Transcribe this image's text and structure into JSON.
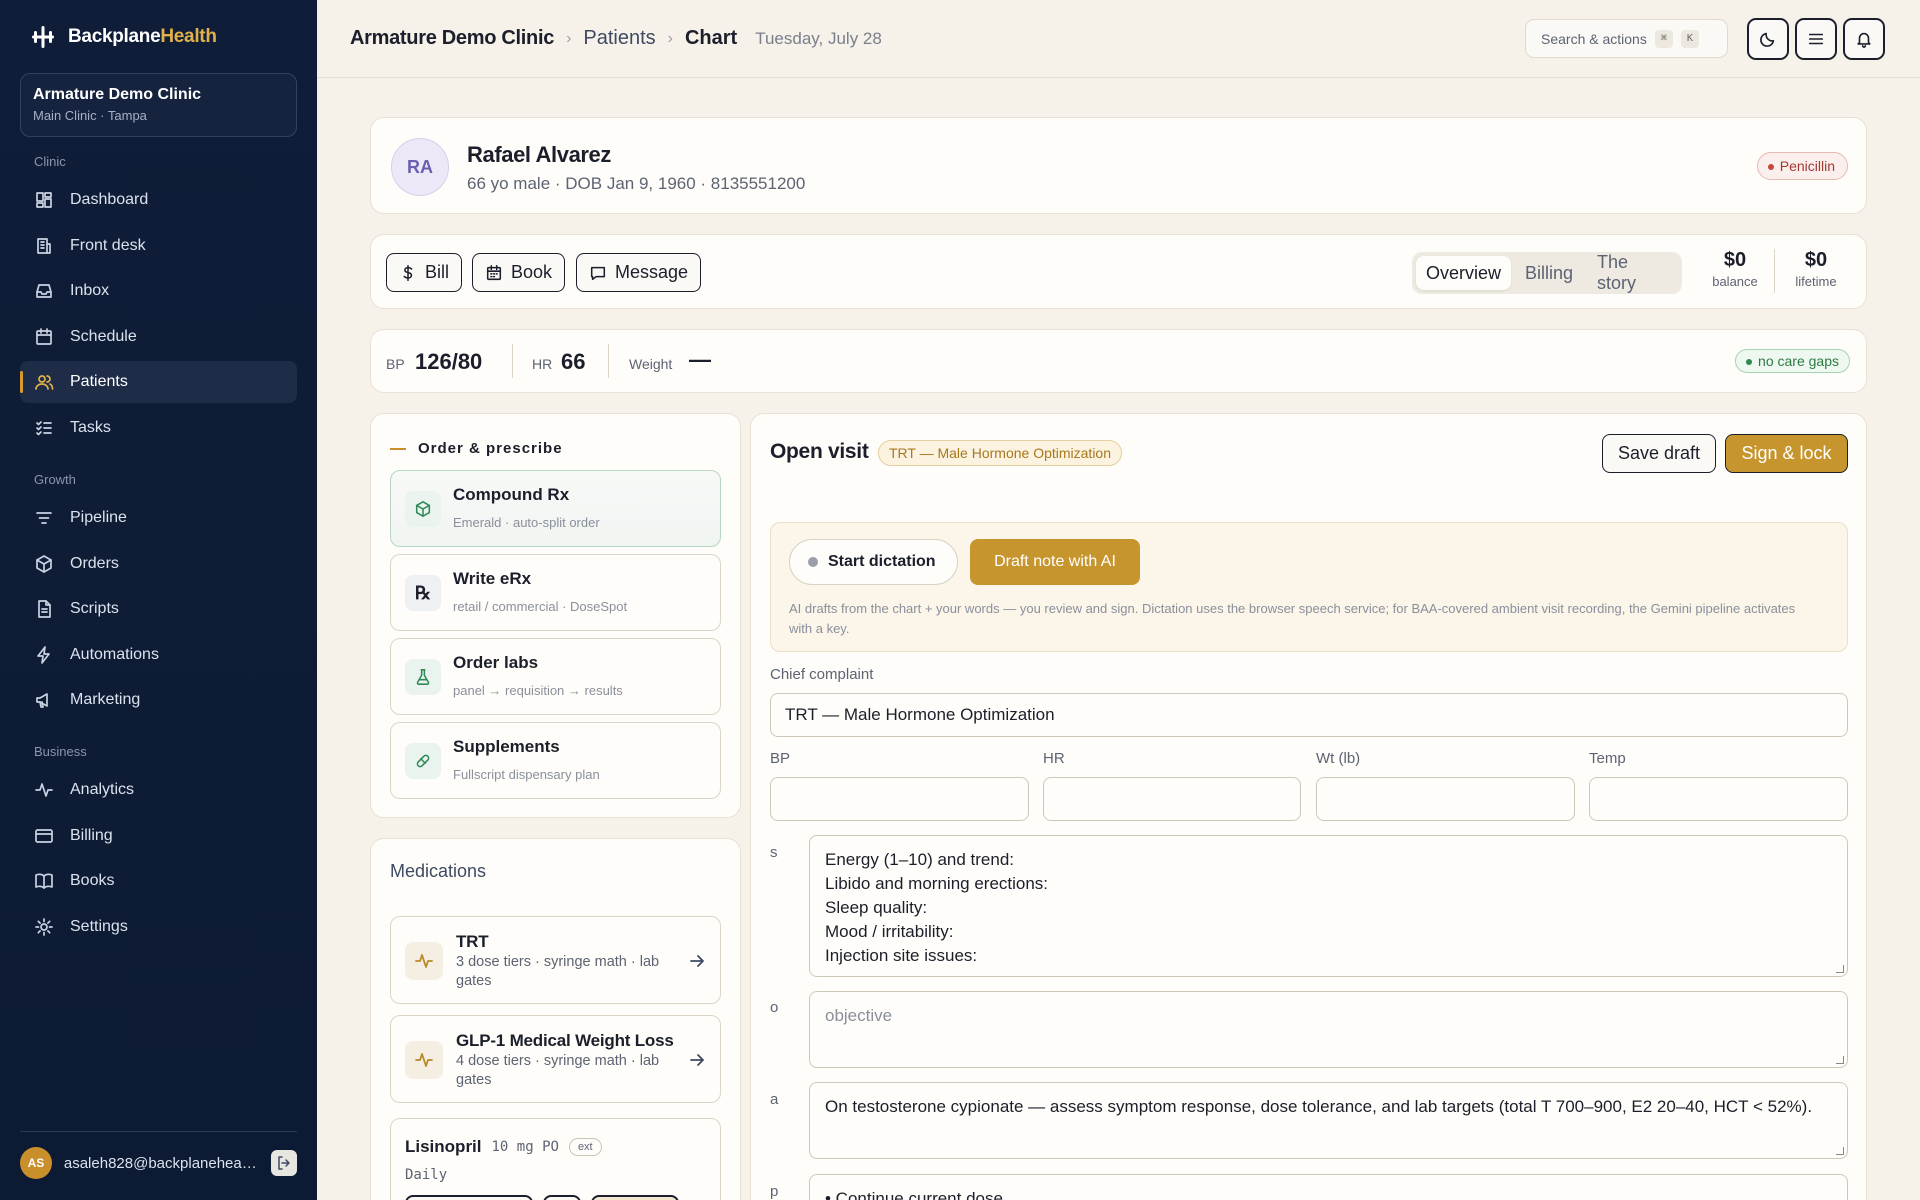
{
  "brand": {
    "name": "Backplane",
    "accent": "Health"
  },
  "clinic": {
    "name": "Armature Demo Clinic",
    "location": "Main Clinic · Tampa"
  },
  "nav": {
    "sections": [
      "Clinic",
      "Growth",
      "Business"
    ],
    "items": [
      {
        "label": "Dashboard",
        "icon": "dashboard-icon"
      },
      {
        "label": "Front desk",
        "icon": "building-icon"
      },
      {
        "label": "Inbox",
        "icon": "inbox-icon"
      },
      {
        "label": "Schedule",
        "icon": "calendar-icon"
      },
      {
        "label": "Patients",
        "icon": "users-icon",
        "active": true
      },
      {
        "label": "Tasks",
        "icon": "checklist-icon"
      },
      {
        "label": "Pipeline",
        "icon": "filter-icon"
      },
      {
        "label": "Orders",
        "icon": "box-icon"
      },
      {
        "label": "Scripts",
        "icon": "document-icon"
      },
      {
        "label": "Automations",
        "icon": "bolt-icon"
      },
      {
        "label": "Marketing",
        "icon": "megaphone-icon"
      },
      {
        "label": "Analytics",
        "icon": "activity-icon"
      },
      {
        "label": "Billing",
        "icon": "credit-card-icon"
      },
      {
        "label": "Books",
        "icon": "book-icon"
      },
      {
        "label": "Settings",
        "icon": "gear-icon"
      }
    ]
  },
  "user": {
    "initials": "AS",
    "email": "asaleh828@backplanehealth.com"
  },
  "topbar": {
    "breadcrumb": [
      "Armature Demo Clinic",
      "Patients",
      "Chart"
    ],
    "date": "Tuesday, July 28",
    "search_placeholder": "Search & actions",
    "kbd": [
      "⌘",
      "K"
    ]
  },
  "patient": {
    "initials": "RA",
    "name": "Rafael Alvarez",
    "summary": "66 yo male · DOB Jan 9, 1960 · 8135551200",
    "allergy": "Penicillin"
  },
  "actions": {
    "buttons": [
      "Bill",
      "Book",
      "Message"
    ],
    "tabs": [
      "Overview",
      "Billing",
      "The story"
    ],
    "balance": {
      "value": "$0",
      "label": "balance"
    },
    "lifetime": {
      "value": "$0",
      "label": "lifetime"
    }
  },
  "vitals": {
    "bp": {
      "label": "BP",
      "value": "126/80"
    },
    "hr": {
      "label": "HR",
      "value": "66"
    },
    "weight": {
      "label": "Weight",
      "value": "—"
    },
    "care_gaps": "no care gaps"
  },
  "order": {
    "title": "Order & prescribe",
    "items": [
      {
        "title": "Compound Rx",
        "sub": "Emerald · auto-split order"
      },
      {
        "title": "Write eRx",
        "sub": "retail / commercial · DoseSpot"
      },
      {
        "title": "Order labs",
        "sub": "panel → requisition → results"
      },
      {
        "title": "Supplements",
        "sub": "Fullscript dispensary plan"
      }
    ]
  },
  "medications": {
    "title": "Medications",
    "programs": [
      {
        "title": "TRT",
        "sub": "3 dose tiers · syringe math · lab gates"
      },
      {
        "title": "GLP-1 Medical Weight Loss",
        "sub": "4 dose tiers · syringe math · lab gates"
      }
    ],
    "rx": {
      "name": "Lisinopril",
      "dose": "10 mg PO",
      "badge": "ext",
      "freq": "Daily"
    }
  },
  "visit": {
    "title": "Open visit",
    "tag": "TRT — Male Hormone Optimization",
    "save_label": "Save draft",
    "sign_label": "Sign & lock",
    "dictation_label": "Start dictation",
    "draft_label": "Draft note with AI",
    "ai_note": "AI drafts from the chart + your words — you review and sign. Dictation uses the browser speech service; for BAA-covered ambient visit recording, the Gemini pipeline activates with a key.",
    "chief_complaint_label": "Chief complaint",
    "chief_complaint": "TRT — Male Hormone Optimization",
    "vital_fields": [
      "BP",
      "HR",
      "Wt (lb)",
      "Temp"
    ],
    "s_label": "s",
    "s_text": "Energy (1–10) and trend:\nLibido and morning erections:\nSleep quality:\nMood / irritability:\nInjection site issues:",
    "o_label": "o",
    "o_placeholder": "objective",
    "a_label": "a",
    "a_text": "On testosterone cypionate — assess symptom response, dose tolerance, and lab targets (total T 700–900, E2 20–40, HCT < 52%).",
    "p_label": "p",
    "p_text": "• Continue current dose"
  },
  "colors": {
    "sidebar": "#0f1d38",
    "accent": "#c7952e",
    "background": "#f6f2ea"
  }
}
